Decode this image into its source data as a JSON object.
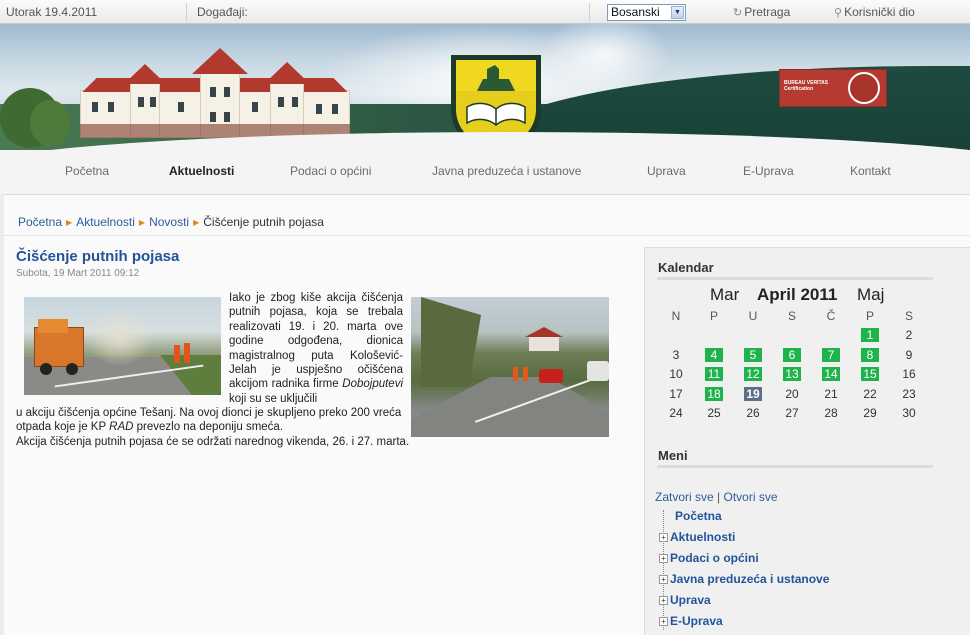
{
  "topbar": {
    "date": "Utorak 19.4.2011",
    "events_label": "Događaji:",
    "language": "Bosanski",
    "search_label": "Pretraga",
    "user_label": "Korisnički dio"
  },
  "certification": {
    "line1": "BUREAU VERITAS",
    "line2": "Certification"
  },
  "nav": {
    "items": [
      "Početna",
      "Aktuelnosti",
      "Podaci o općini",
      "Javna preduzeća i ustanove",
      "Uprava",
      "E-Uprava",
      "Kontakt"
    ],
    "active": "Aktuelnosti"
  },
  "breadcrumb": [
    "Početna",
    "Aktuelnosti",
    "Novosti",
    "Čišćenje putnih pojasa"
  ],
  "article": {
    "title": "Čišćenje putnih pojasa",
    "date": "Subota, 19 Mart 2011 09:12",
    "p1": "Iako je zbog kiše akcija čišćenja putnih pojasa, koja se trebala realizovati 19. i 20. marta ove godine odgođena, dionica magistralnog puta Kološević-Jelah je uspješno očišćena akcijom radnika firme ",
    "p1_em": "Dobojputevi",
    "p1_end": " koji su se uključili",
    "p2": "u akciju čišćenja općine Tešanj. Na ovoj dionci je skupljeno preko 200 vreća otpada koje je KP ",
    "p2_em": "RAD",
    "p2_end": " prevezlo na deponiju smeća.",
    "p3": "Akcija čišćenja putnih pojasa će se održati narednog vikenda, 26. i 27. marta."
  },
  "calendar": {
    "title": "Kalendar",
    "prev": "Mar",
    "current": "April 2011",
    "next": "Maj",
    "weekdays": [
      "N",
      "P",
      "U",
      "S",
      "Č",
      "P",
      "S"
    ],
    "weeks": [
      [
        "",
        "",
        "",
        "",
        "",
        "1",
        "2"
      ],
      [
        "3",
        "4",
        "5",
        "6",
        "7",
        "8",
        "9"
      ],
      [
        "10",
        "11",
        "12",
        "13",
        "14",
        "15",
        "16"
      ],
      [
        "17",
        "18",
        "19",
        "20",
        "21",
        "22",
        "23"
      ],
      [
        "24",
        "25",
        "26",
        "27",
        "28",
        "29",
        "30"
      ]
    ],
    "event_days": [
      "1",
      "4",
      "5",
      "6",
      "7",
      "8",
      "11",
      "12",
      "13",
      "14",
      "15",
      "18"
    ],
    "today": "19",
    "colors": {
      "event": "#1fb34c",
      "today": "#5b6f86"
    }
  },
  "menu": {
    "title": "Meni",
    "close_all": "Zatvori sve",
    "separator": "|",
    "open_all": "Otvori sve",
    "items": [
      "Početna",
      "Aktuelnosti",
      "Podaci o općini",
      "Javna preduzeća i ustanove",
      "Uprava",
      "E-Uprava"
    ]
  }
}
